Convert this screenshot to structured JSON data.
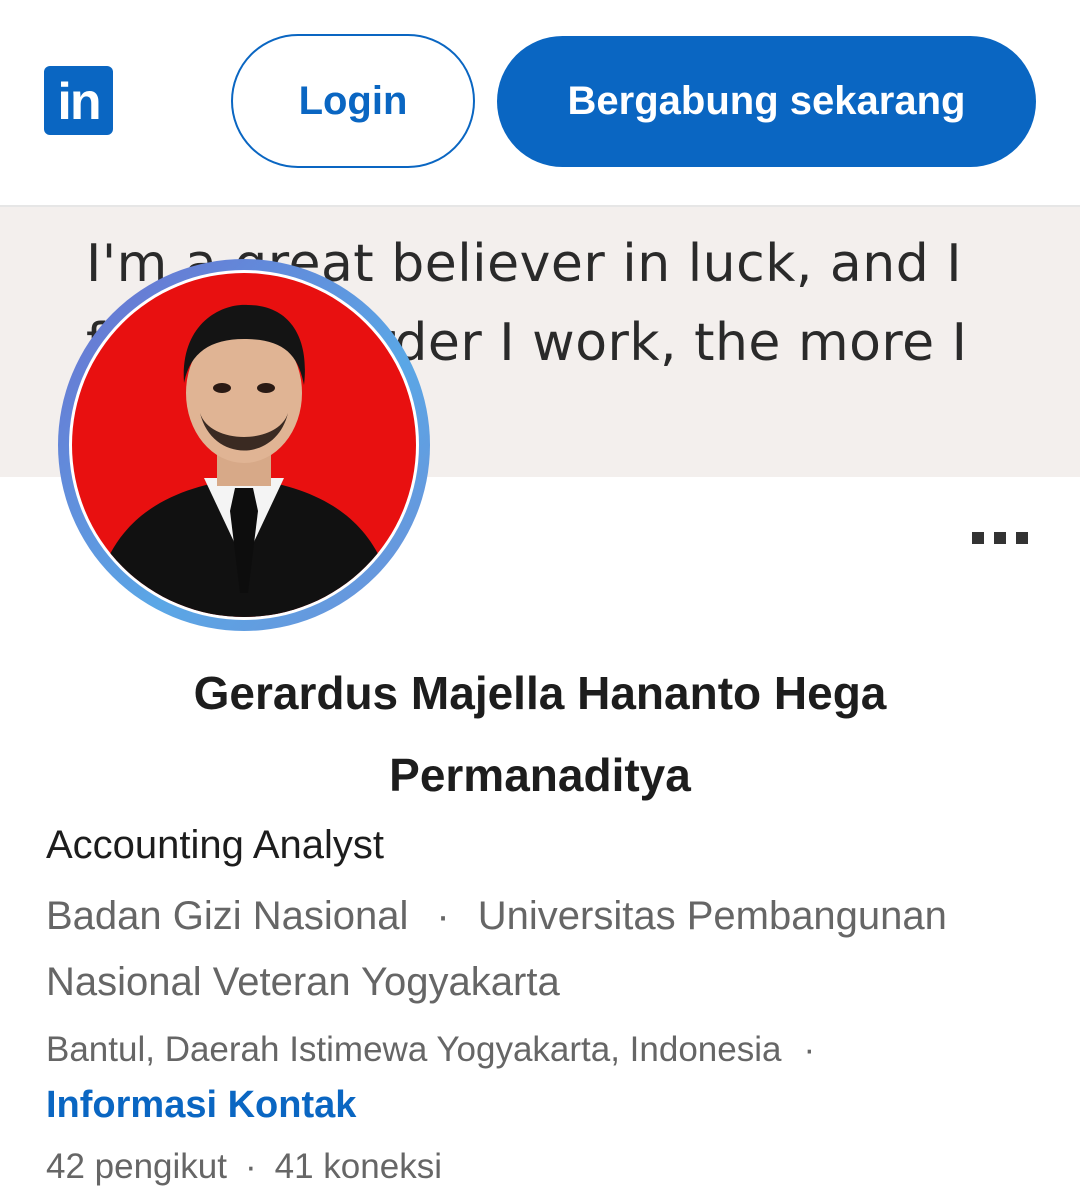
{
  "header": {
    "logo_text": "in",
    "login_label": "Login",
    "join_label": "Bergabung sekarang"
  },
  "banner": {
    "quote": "I'm a great believer in luck, and I find the harder I work, the more I have of it."
  },
  "profile": {
    "name": "Gerardus Majella Hananto Hega Permanaditya",
    "headline": "Accounting Analyst",
    "company": "Badan Gizi Nasional",
    "separator": "·",
    "education": "Universitas Pembangunan Nasional Veteran Yogyakarta",
    "location": "Bantul, Daerah Istimewa Yogyakarta, Indonesia",
    "contact_link": "Informasi Kontak",
    "followers": "42 pengikut",
    "connections": "41 koneksi"
  },
  "colors": {
    "brand": "#0a66c2",
    "avatar_background": "#e81010",
    "banner_background": "#f3efed"
  },
  "icons": {
    "logo": "linkedin-logo-icon",
    "more": "more-options-icon"
  }
}
